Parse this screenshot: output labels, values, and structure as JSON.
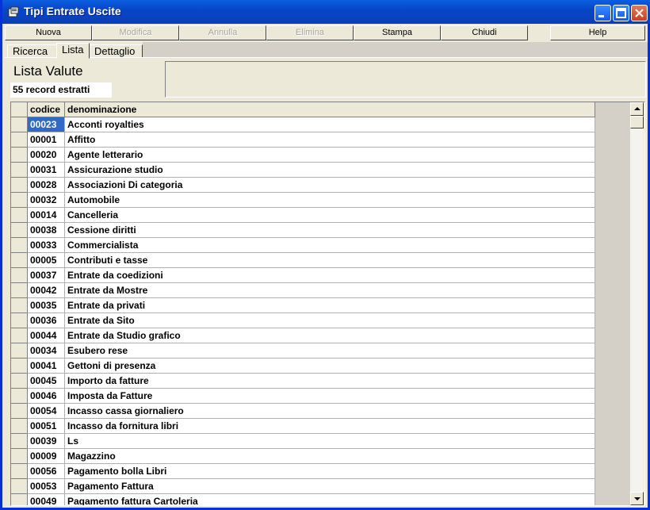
{
  "window": {
    "title": "Tipi Entrate Uscite"
  },
  "toolbar": {
    "nuova": "Nuova",
    "modifica": "Modifica",
    "annulla": "Annulla",
    "elimina": "Elimina",
    "stampa": "Stampa",
    "chiudi": "Chiudi",
    "help": "Help"
  },
  "tabs": [
    "Ricerca",
    "Lista",
    "Dettaglio"
  ],
  "active_tab": "Lista",
  "panel": {
    "title": "Lista Valute",
    "record_count": "55 record estratti"
  },
  "grid": {
    "headers": {
      "code": "codice",
      "name": "denominazione"
    },
    "rows": [
      {
        "code": "00023",
        "name": "Acconti royalties"
      },
      {
        "code": "00001",
        "name": "Affitto"
      },
      {
        "code": "00020",
        "name": "Agente letterario"
      },
      {
        "code": "00031",
        "name": "Assicurazione studio"
      },
      {
        "code": "00028",
        "name": "Associazioni Di categoria"
      },
      {
        "code": "00032",
        "name": "Automobile"
      },
      {
        "code": "00014",
        "name": "Cancelleria"
      },
      {
        "code": "00038",
        "name": "Cessione diritti"
      },
      {
        "code": "00033",
        "name": "Commercialista"
      },
      {
        "code": "00005",
        "name": "Contributi e tasse"
      },
      {
        "code": "00037",
        "name": "Entrate da coedizioni"
      },
      {
        "code": "00042",
        "name": "Entrate da Mostre"
      },
      {
        "code": "00035",
        "name": "Entrate da privati"
      },
      {
        "code": "00036",
        "name": "Entrate da Sito"
      },
      {
        "code": "00044",
        "name": "Entrate da Studio grafico"
      },
      {
        "code": "00034",
        "name": "Esubero rese"
      },
      {
        "code": "00041",
        "name": "Gettoni di presenza"
      },
      {
        "code": "00045",
        "name": "Importo da fatture"
      },
      {
        "code": "00046",
        "name": "Imposta da Fatture"
      },
      {
        "code": "00054",
        "name": "Incasso cassa giornaliero"
      },
      {
        "code": "00051",
        "name": "Incasso da fornitura libri"
      },
      {
        "code": "00039",
        "name": "Ls"
      },
      {
        "code": "00009",
        "name": "Magazzino"
      },
      {
        "code": "00056",
        "name": "Pagamento bolla Libri"
      },
      {
        "code": "00053",
        "name": "Pagamento Fattura"
      },
      {
        "code": "00049",
        "name": "Pagamento fattura Cartoleria"
      }
    ]
  },
  "colors": {
    "title_bar": "#0846c8",
    "selection": "#316ac5",
    "face": "#ece9d8"
  }
}
